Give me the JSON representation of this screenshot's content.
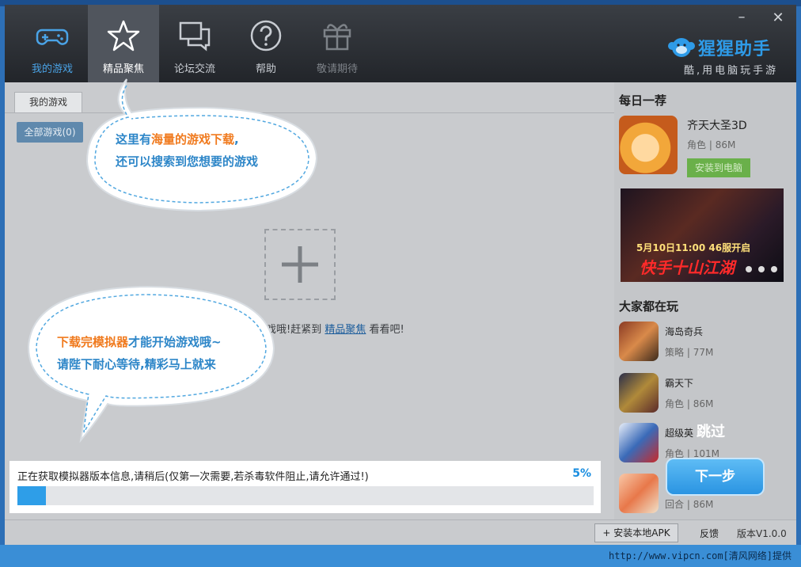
{
  "nav": {
    "items": [
      {
        "label": "我的游戏",
        "icon": "gamepad-icon"
      },
      {
        "label": "精品聚焦",
        "icon": "star-icon"
      },
      {
        "label": "论坛交流",
        "icon": "chat-bubbles-icon"
      },
      {
        "label": "帮助",
        "icon": "question-icon"
      },
      {
        "label": "敬请期待",
        "icon": "gift-icon"
      }
    ],
    "active_index": 1
  },
  "brand": {
    "name": "猩猩助手",
    "slogan": "酷,用电脑玩手游"
  },
  "tabs": {
    "mygames": "我的游戏"
  },
  "filter": {
    "all_games": "全部游戏(0)"
  },
  "empty_state": {
    "text_before": "戏哦!赶紧到 ",
    "link": "精品聚焦",
    "text_after": " 看看吧!"
  },
  "guide": {
    "top_line1_pre": "这里有",
    "top_line1_hl": "海量的游戏下载",
    "top_line1_post": ",",
    "top_line2": "还可以搜索到您想要的游戏",
    "bottom_line1_hl": "下载完模拟器",
    "bottom_line1_post": "才能开始游戏哦~",
    "bottom_line2": "请陛下耐心等待,精彩马上就来",
    "skip": "跳过",
    "next": "下一步"
  },
  "progress": {
    "text": "正在获取模拟器版本信息,请稍后(仅第一次需要,若杀毒软件阻止,请允许通过!)",
    "percent_label": "5%",
    "value": 0.05,
    "color": "#2e9ee8"
  },
  "sidebar": {
    "daily_title": "每日一荐",
    "daily": {
      "name": "齐天大圣3D",
      "category": "角色",
      "size": "86M",
      "install": "安装到电脑"
    },
    "banner": {
      "line1": "5月10日11:00 46服开启",
      "line2": "快手十山江湖"
    },
    "popular_title": "大家都在玩",
    "popular": [
      {
        "name": "海岛奇兵",
        "category": "策略",
        "size": "77M"
      },
      {
        "name": "霸天下",
        "category": "角色",
        "size": "86M"
      },
      {
        "name": "超级英",
        "category": "角色",
        "size": "101M"
      },
      {
        "name": "",
        "category": "回合",
        "size": "86M"
      }
    ]
  },
  "footer": {
    "install_apk": "安装本地APK",
    "feedback": "反馈",
    "version": "版本V1.0.0"
  },
  "watermark": "http://www.vipcn.com[清风网络]提供"
}
